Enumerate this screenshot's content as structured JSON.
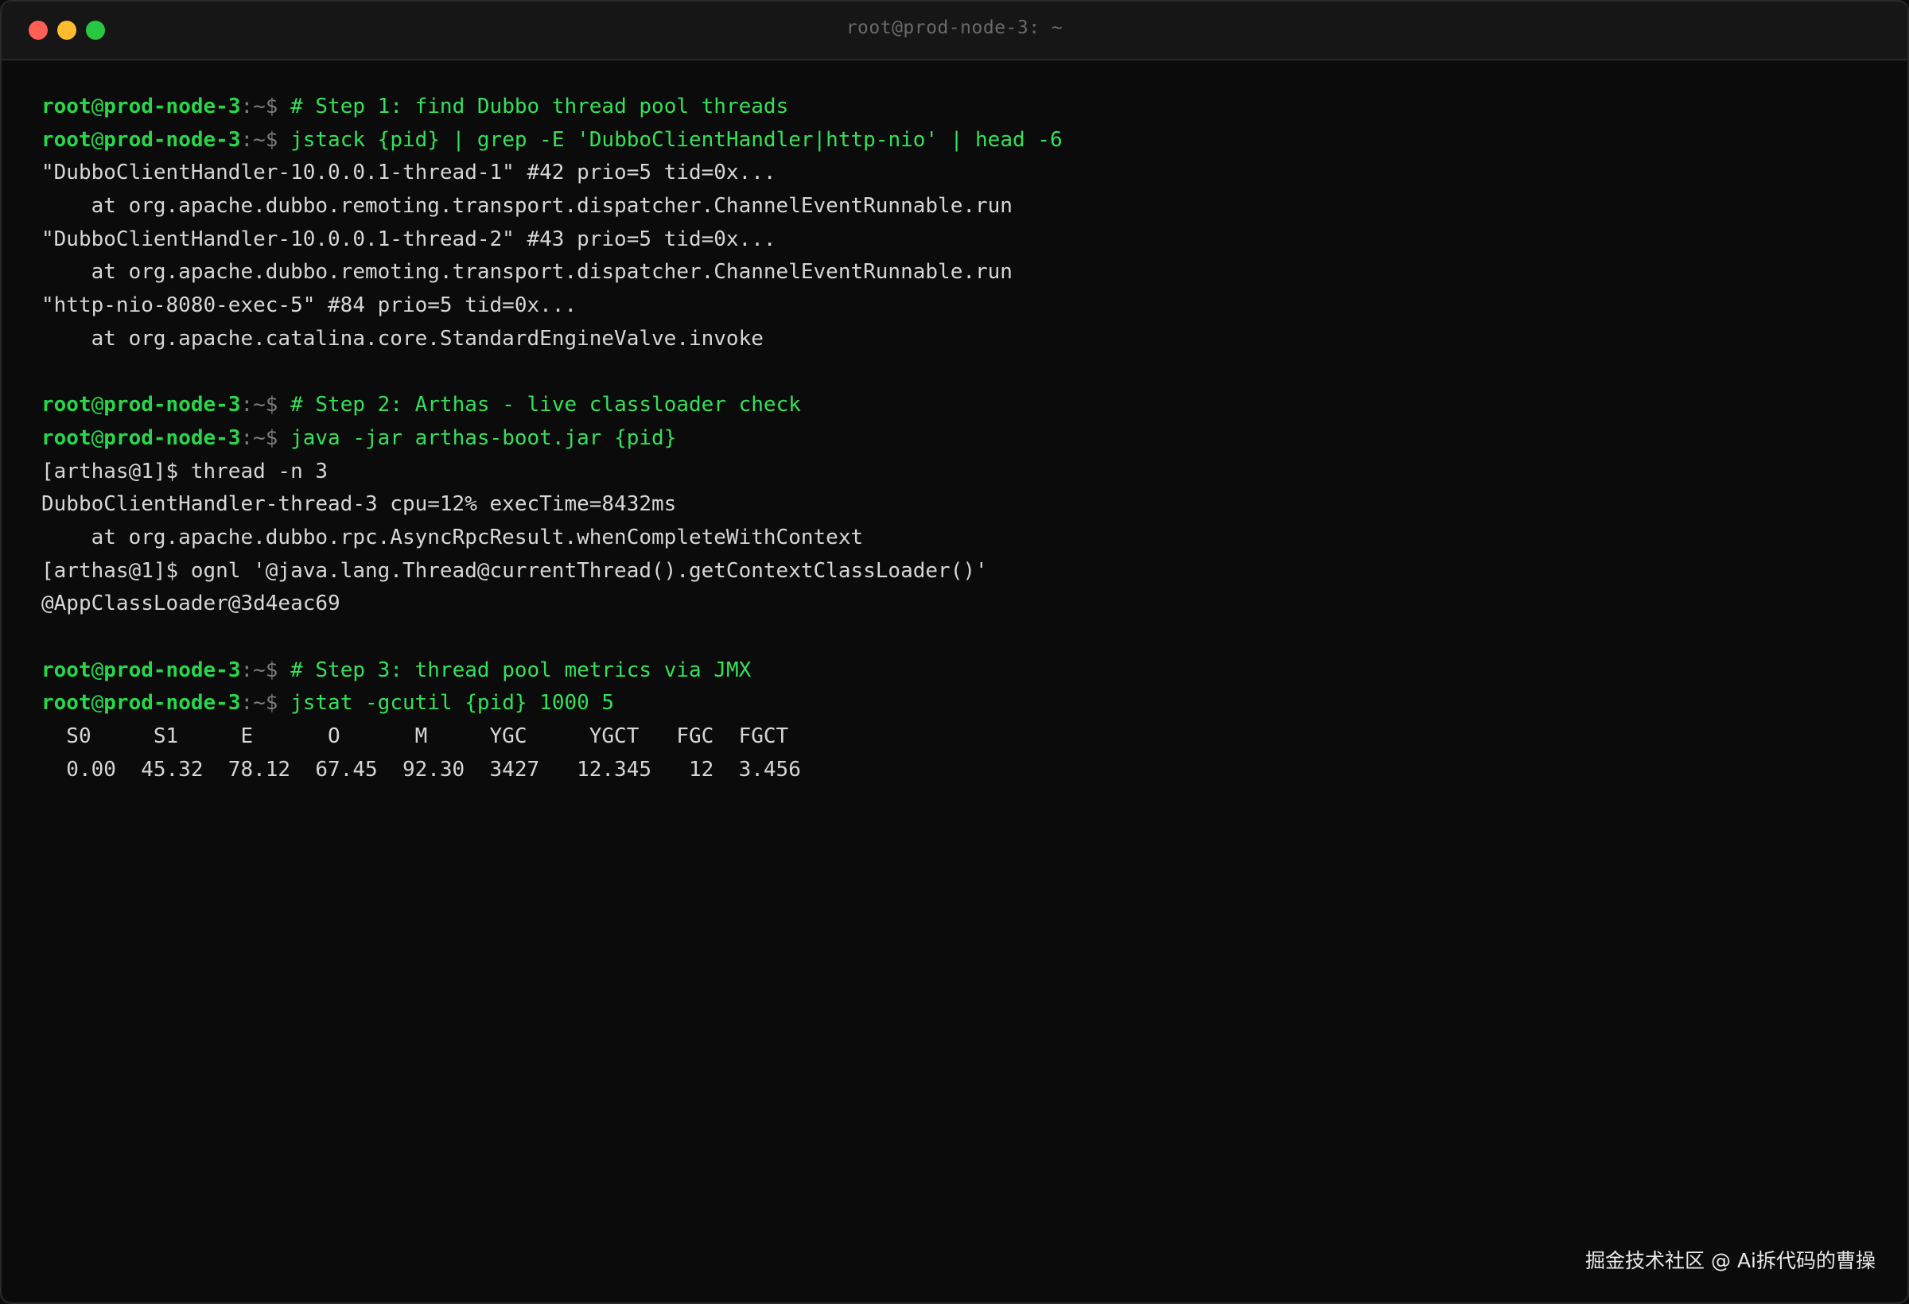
{
  "window": {
    "title": "root@prod-node-3: ~"
  },
  "prompt": {
    "user": "root",
    "at": "@",
    "host": "prod-node-3",
    "path": ":~$ "
  },
  "lines": [
    {
      "type": "prompt",
      "text": "# Step 1: find Dubbo thread pool threads"
    },
    {
      "type": "prompt",
      "text": "jstack {pid} | grep -E 'DubboClientHandler|http-nio' | head -6"
    },
    {
      "type": "output",
      "text": "\"DubboClientHandler-10.0.0.1-thread-1\" #42 prio=5 tid=0x..."
    },
    {
      "type": "output",
      "text": "    at org.apache.dubbo.remoting.transport.dispatcher.ChannelEventRunnable.run"
    },
    {
      "type": "output",
      "text": "\"DubboClientHandler-10.0.0.1-thread-2\" #43 prio=5 tid=0x..."
    },
    {
      "type": "output",
      "text": "    at org.apache.dubbo.remoting.transport.dispatcher.ChannelEventRunnable.run"
    },
    {
      "type": "output",
      "text": "\"http-nio-8080-exec-5\" #84 prio=5 tid=0x..."
    },
    {
      "type": "output",
      "text": "    at org.apache.catalina.core.StandardEngineValve.invoke"
    },
    {
      "type": "blank",
      "text": ""
    },
    {
      "type": "prompt",
      "text": "# Step 2: Arthas - live classloader check"
    },
    {
      "type": "prompt",
      "text": "java -jar arthas-boot.jar {pid}"
    },
    {
      "type": "output",
      "text": "[arthas@1]$ thread -n 3"
    },
    {
      "type": "output",
      "text": "DubboClientHandler-thread-3 cpu=12% execTime=8432ms"
    },
    {
      "type": "output",
      "text": "    at org.apache.dubbo.rpc.AsyncRpcResult.whenCompleteWithContext"
    },
    {
      "type": "output",
      "text": "[arthas@1]$ ognl '@java.lang.Thread@currentThread().getContextClassLoader()'"
    },
    {
      "type": "output",
      "text": "@AppClassLoader@3d4eac69"
    },
    {
      "type": "blank",
      "text": ""
    },
    {
      "type": "prompt",
      "text": "# Step 3: thread pool metrics via JMX"
    },
    {
      "type": "prompt",
      "text": "jstat -gcutil {pid} 1000 5"
    },
    {
      "type": "output",
      "text": "  S0     S1     E      O      M     YGC     YGCT   FGC  FGCT"
    },
    {
      "type": "output",
      "text": "  0.00  45.32  78.12  67.45  92.30  3427   12.345   12  3.456"
    }
  ],
  "watermark": "掘金技术社区 @ Ai拆代码的曹操",
  "colors": {
    "prompt_green": "#29d64a",
    "command_green": "#35e05a",
    "output_text": "#d6d6d6",
    "background": "#0b0b0b"
  }
}
